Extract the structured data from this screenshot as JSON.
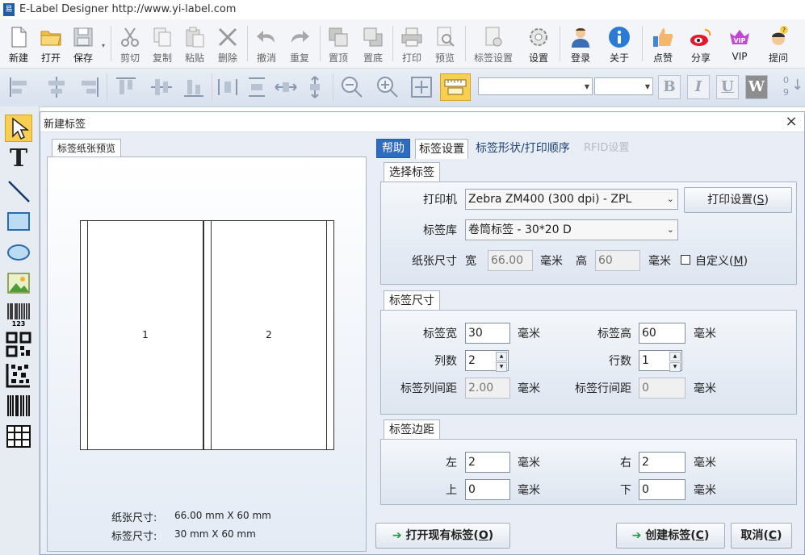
{
  "app": {
    "title": "E-Label Designer http://www.yi-label.com"
  },
  "toolbar": {
    "new": "新建",
    "open": "打开",
    "save": "保存",
    "cut": "剪切",
    "copy": "复制",
    "paste": "粘贴",
    "delete": "删除",
    "undo": "撤消",
    "redo": "重复",
    "bring_front": "置顶",
    "send_back": "置底",
    "print": "打印",
    "preview": "预览",
    "label_settings": "标签设置",
    "settings": "设置",
    "login": "登录",
    "about": "关于",
    "like": "点赞",
    "share": "分享",
    "vip": "VIP",
    "ask": "提问"
  },
  "format": {
    "bold": "B",
    "italic": "I",
    "underline": "U",
    "wrap": "W",
    "sort_top": "0",
    "sort_bottom": "9"
  },
  "dialog": {
    "title": "新建标签",
    "close": "×",
    "preview_tab": "标签纸张预览",
    "preview_labels": [
      "1",
      "2"
    ],
    "paper_size_label": "纸张尺寸:",
    "paper_size_value": "66.00 mm X 60 mm",
    "label_size_label": "标签尺寸:",
    "label_size_value": "30 mm X 60 mm",
    "tabs": {
      "help": "帮助",
      "label_settings": "标签设置",
      "shape_order": "标签形状/打印顺序",
      "rfid": "RFID设置"
    },
    "select_group": {
      "title": "选择标签",
      "printer_label": "打印机",
      "printer_value": "Zebra ZM400 (300 dpi) - ZPL",
      "print_settings_btn": "打印设置(",
      "print_settings_key": "S",
      "library_label": "标签库",
      "library_value": "卷筒标签 - 30*20 D",
      "paper_label": "纸张尺寸",
      "width_label": "宽",
      "width_value": "66.00",
      "unit": "毫米",
      "height_label": "高",
      "height_value": "60",
      "custom_label": "自定义(",
      "custom_key": "M"
    },
    "size_group": {
      "title": "标签尺寸",
      "label_width_label": "标签宽",
      "label_width_value": "30",
      "label_height_label": "标签高",
      "label_height_value": "60",
      "columns_label": "列数",
      "columns_value": "2",
      "rows_label": "行数",
      "rows_value": "1",
      "col_gap_label": "标签列间距",
      "col_gap_value": "2.00",
      "row_gap_label": "标签行间距",
      "row_gap_value": "0",
      "unit": "毫米"
    },
    "margin_group": {
      "title": "标签边距",
      "left_label": "左",
      "left_value": "2",
      "right_label": "右",
      "right_value": "2",
      "top_label": "上",
      "top_value": "0",
      "bottom_label": "下",
      "bottom_value": "0",
      "unit": "毫米"
    },
    "buttons": {
      "open_existing": "打开现有标签(",
      "open_key": "O",
      "create": "创建标签(",
      "create_key": "C",
      "cancel": "取消(",
      "cancel_key": "C"
    }
  },
  "colors": {
    "accent_tab": "#2d6cc0",
    "toolbar_bg": "#f3f5f8",
    "dialog_bg": "#e9eef6",
    "arrow_green": "#1e9a3a"
  }
}
